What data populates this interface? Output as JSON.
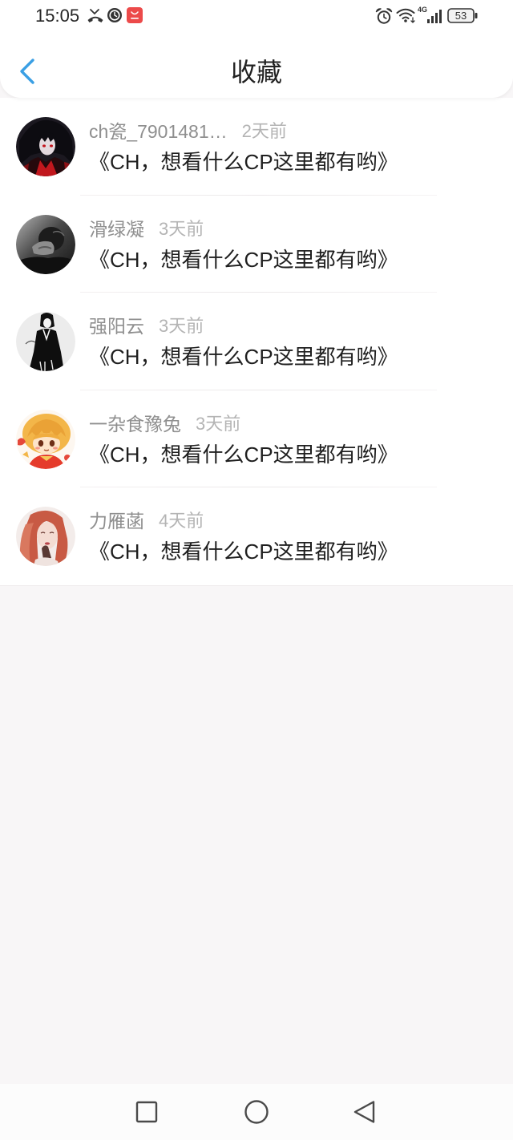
{
  "theme": {
    "accent": "#3a9fe4",
    "text": "#222222",
    "muted": "#8f8f8f",
    "muted_light": "#b4b4b4",
    "page_bg": "#f8f6f7",
    "icon": "#4a4a4a",
    "app_badge_red": "#ec4a4a"
  },
  "status_bar": {
    "time": "15:05",
    "network_type": "4G",
    "battery_level": "53",
    "icons_left": [
      "missed-call-icon",
      "timer-icon",
      "app-notification-icon"
    ],
    "icons_right": [
      "alarm-icon",
      "wifi-icon",
      "signal-icon",
      "battery-icon"
    ]
  },
  "header": {
    "title": "收藏",
    "back_icon": "chevron-left-icon"
  },
  "favorites": [
    {
      "name": "ch瓷_7901481…",
      "time": "2天前",
      "message": "《CH，想看什么CP这里都有哟》"
    },
    {
      "name": "滑绿凝",
      "time": "3天前",
      "message": "《CH，想看什么CP这里都有哟》"
    },
    {
      "name": "强阳云",
      "time": "3天前",
      "message": "《CH，想看什么CP这里都有哟》"
    },
    {
      "name": "一杂食豫兔",
      "time": "3天前",
      "message": "《CH，想看什么CP这里都有哟》"
    },
    {
      "name": "力雁菡",
      "time": "4天前",
      "message": "《CH，想看什么CP这里都有哟》"
    }
  ],
  "nav_bar": {
    "icons": [
      "recent-apps-icon",
      "home-icon",
      "back-icon"
    ]
  }
}
